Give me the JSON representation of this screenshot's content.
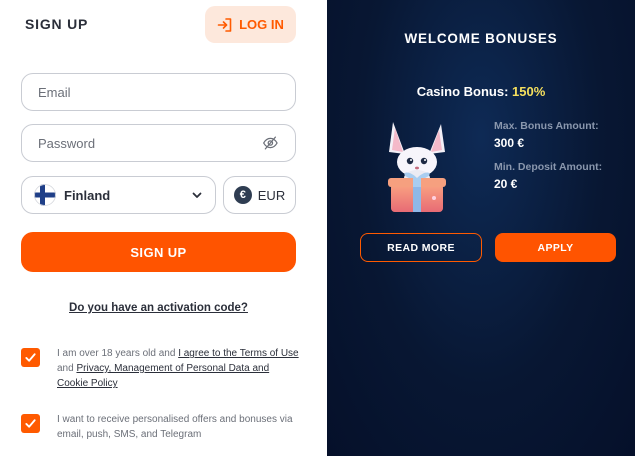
{
  "header": {
    "title": "SIGN UP",
    "login_label": "LOG IN"
  },
  "form": {
    "email_placeholder": "Email",
    "password_placeholder": "Password",
    "country": "Finland",
    "currency": "EUR",
    "currency_symbol": "€",
    "submit_label": "SIGN UP",
    "activation_link": "Do you have an activation code?"
  },
  "consents": {
    "age": {
      "checked": true,
      "prefix": "I am over 18 years old and ",
      "link1": "I agree to the Terms of Use",
      "middle": " and ",
      "link2": "Privacy, Management of Personal Data and Cookie Policy"
    },
    "marketing": {
      "checked": true,
      "text": "I want to receive personalised offers and bonuses via email, push, SMS, and Telegram"
    }
  },
  "bonus": {
    "title": "WELCOME BONUSES",
    "casino_label": "Casino Bonus:",
    "casino_percent": "150%",
    "max_label": "Max. Bonus Amount:",
    "max_value": "300 €",
    "min_label": "Min. Deposit Amount:",
    "min_value": "20 €",
    "read_more_label": "READ MORE",
    "apply_label": "APPLY"
  },
  "colors": {
    "accent": "#ff5400",
    "panel_dark": "#081733",
    "highlight": "#f6e05e"
  },
  "icons": {
    "login": "login-arrow-icon",
    "password_toggle": "eye-off-icon",
    "country_flag": "finland-flag-icon",
    "dropdown": "chevron-down-icon",
    "currency": "euro-icon",
    "checkbox": "check-icon",
    "mascot": "fox-gift-mascot"
  }
}
